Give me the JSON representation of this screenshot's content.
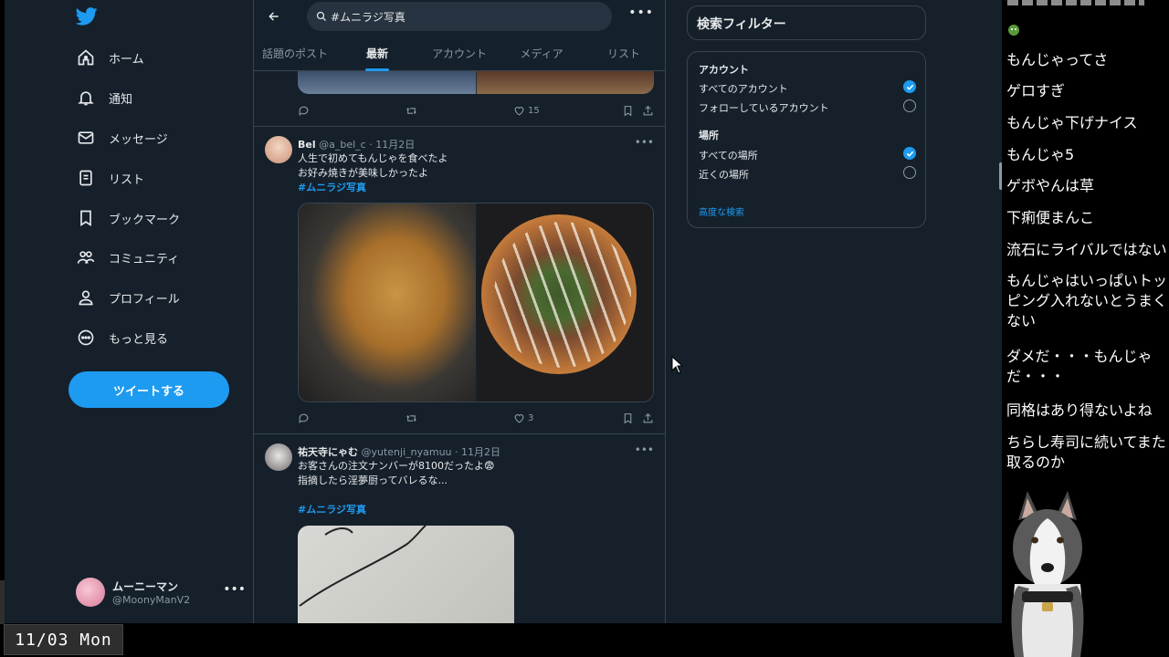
{
  "nav": {
    "items": [
      {
        "label": "ホーム",
        "icon": "home-icon"
      },
      {
        "label": "通知",
        "icon": "bell-icon"
      },
      {
        "label": "メッセージ",
        "icon": "mail-icon"
      },
      {
        "label": "リスト",
        "icon": "list-icon"
      },
      {
        "label": "ブックマーク",
        "icon": "bookmark-icon"
      },
      {
        "label": "コミュニティ",
        "icon": "community-icon"
      },
      {
        "label": "プロフィール",
        "icon": "profile-icon"
      },
      {
        "label": "もっと見る",
        "icon": "more-circle-icon"
      }
    ],
    "tweet_button": "ツイートする",
    "account": {
      "name": "ムーニーマン",
      "handle": "@MoonyManV2"
    }
  },
  "search": {
    "query": "#ムニラジ写真"
  },
  "tabs": [
    "話題のポスト",
    "最新",
    "アカウント",
    "メディア",
    "リスト"
  ],
  "active_tab": "最新",
  "tweets": [
    {
      "likes": "15"
    },
    {
      "name": "Bel",
      "handle": "@a_bel_c",
      "date": "11月2日",
      "line1": "人生で初めてもんじゃを食べたよ",
      "line2": "お好み焼きが美味しかったよ",
      "hashtag": "#ムニラジ写真",
      "likes": "3"
    },
    {
      "name": "祐天寺にゃむ",
      "handle": "@yutenji_nyamuu",
      "date": "11月2日",
      "line1": "お客さんの注文ナンバーが8100だったよ😨",
      "line2": "指摘したら淫夢厨ってバレるな...",
      "hashtag": "#ムニラジ写真"
    }
  ],
  "filters": {
    "title": "検索フィルター",
    "account_heading": "アカウント",
    "account_opts": [
      {
        "label": "すべてのアカウント",
        "checked": true
      },
      {
        "label": "フォローしているアカウント",
        "checked": false
      }
    ],
    "place_heading": "場所",
    "place_opts": [
      {
        "label": "すべての場所",
        "checked": true
      },
      {
        "label": "近くの場所",
        "checked": false
      }
    ],
    "advanced": "高度な検索"
  },
  "chat": [
    "もんじゃってさ",
    "ゲロすぎ",
    "もんじゃ下げナイス",
    "もんじゃ5",
    "ゲボやんは草",
    "下痢便まんこ",
    "流石にライバルではない",
    "もんじゃはいっぱいトッピング入れないとうまくない",
    "ダメだ・・・もんじゃだ・・・",
    "同格はあり得ないよね",
    "ちらし寿司に続いてまた取るのか"
  ],
  "date_overlay": "11/03 Mon",
  "colors": {
    "bg": "#15202b",
    "accent": "#1d9bf0",
    "border": "#38444d",
    "muted": "#8b98a5"
  }
}
